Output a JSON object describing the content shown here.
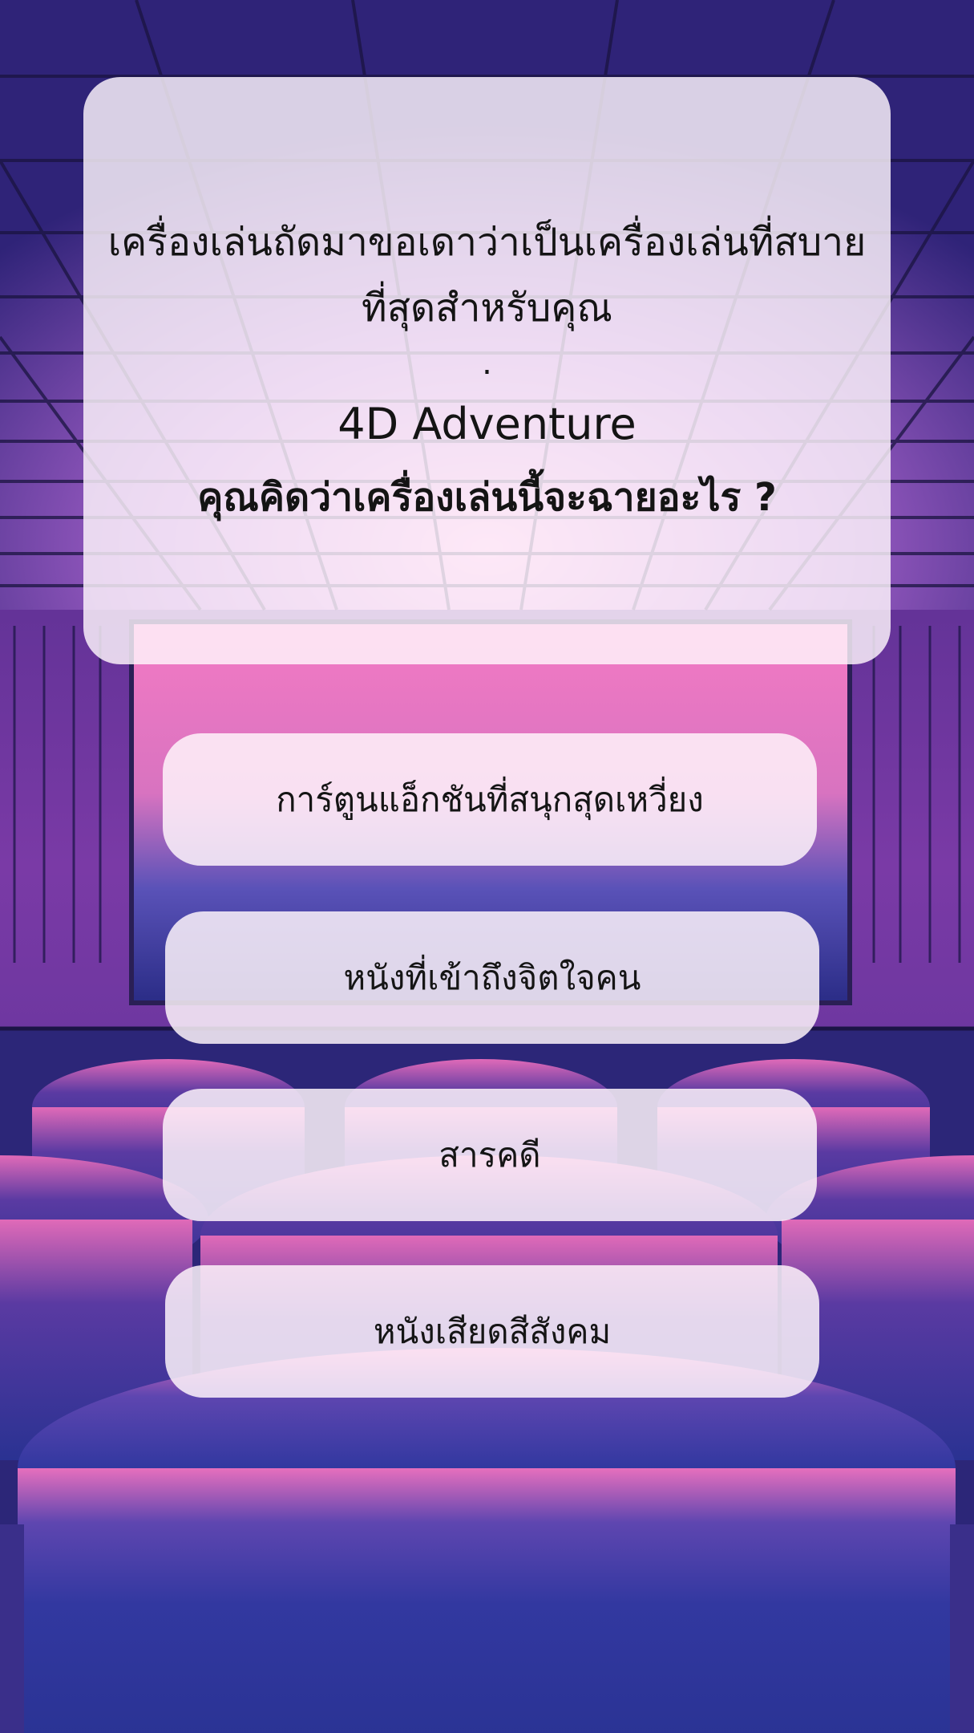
{
  "question": {
    "line1": "เครื่องเล่นถัดมาขอเดาว่าเป็นเครื่องเล่นที่สบาย",
    "line2": "ที่สุดสำหรับคุณ",
    "separator": ".",
    "ride_name": "4D Adventure",
    "prompt": "คุณคิดว่าเครื่องเล่นนี้จะฉายอะไร ?"
  },
  "answers": [
    {
      "label": "การ์ตูนแอ็กชันที่สนุกสุดเหวี่ยง"
    },
    {
      "label": "หนังที่เข้าถึงจิตใจคน"
    },
    {
      "label": "สารคดี"
    },
    {
      "label": "หนังเสียดสีสังคม"
    }
  ],
  "colors": {
    "background_top": "#3a2a86",
    "screen_glow": "#f07ac3",
    "seat_blue": "#2c3490",
    "card": "#fff6fc"
  },
  "background_scene": "cinema-theater-illustration"
}
